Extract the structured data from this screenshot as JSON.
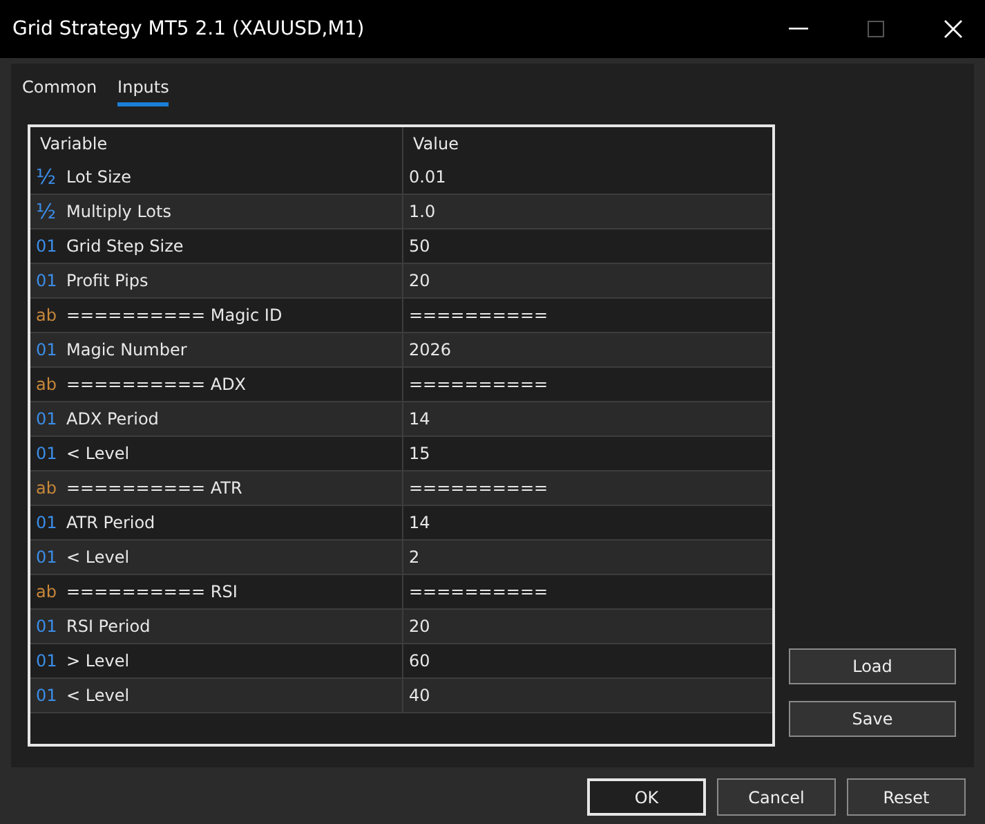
{
  "window": {
    "title": "Grid Strategy MT5 2.1 (XAUUSD,M1)",
    "maximize_disabled": true
  },
  "tabs": [
    {
      "label": "Common",
      "selected": false
    },
    {
      "label": "Inputs",
      "selected": true
    }
  ],
  "table": {
    "columns": [
      "Variable",
      "Value"
    ],
    "rows": [
      {
        "kind": "double",
        "icon": "½",
        "variable": "Lot Size",
        "value": "0.01"
      },
      {
        "kind": "double",
        "icon": "½",
        "variable": "Multiply Lots",
        "value": "1.0"
      },
      {
        "kind": "int",
        "icon": "01",
        "variable": "Grid Step Size",
        "value": "50"
      },
      {
        "kind": "int",
        "icon": "01",
        "variable": "Profit Pips",
        "value": "20"
      },
      {
        "kind": "string",
        "icon": "ab",
        "variable": "========== Magic ID",
        "value": "=========="
      },
      {
        "kind": "int",
        "icon": "01",
        "variable": "Magic Number",
        "value": "2026"
      },
      {
        "kind": "string",
        "icon": "ab",
        "variable": "========== ADX",
        "value": "=========="
      },
      {
        "kind": "int",
        "icon": "01",
        "variable": "ADX Period",
        "value": "14"
      },
      {
        "kind": "int",
        "icon": "01",
        "variable": "< Level",
        "value": "15"
      },
      {
        "kind": "string",
        "icon": "ab",
        "variable": "========== ATR",
        "value": "=========="
      },
      {
        "kind": "int",
        "icon": "01",
        "variable": "ATR Period",
        "value": "14"
      },
      {
        "kind": "int",
        "icon": "01",
        "variable": "< Level",
        "value": "2"
      },
      {
        "kind": "string",
        "icon": "ab",
        "variable": "========== RSI",
        "value": "=========="
      },
      {
        "kind": "int",
        "icon": "01",
        "variable": "RSI Period",
        "value": "20"
      },
      {
        "kind": "int",
        "icon": "01",
        "variable": "> Level",
        "value": "60"
      },
      {
        "kind": "int",
        "icon": "01",
        "variable": "< Level",
        "value": "40"
      }
    ]
  },
  "side_buttons": [
    "Load",
    "Save"
  ],
  "buttons": [
    {
      "label": "OK",
      "default": true
    },
    {
      "label": "Cancel",
      "default": false
    },
    {
      "label": "Reset",
      "default": false
    }
  ]
}
